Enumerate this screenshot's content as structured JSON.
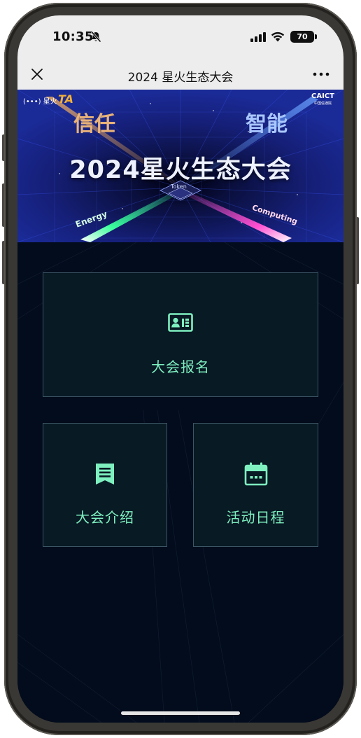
{
  "status_bar": {
    "time": "10:35",
    "battery_level": "70"
  },
  "nav": {
    "title": "2024 星火生态大会"
  },
  "banner": {
    "title": "2024星火生态大会",
    "word_left": "信任",
    "word_right": "智能",
    "label_center": "Token",
    "label_left": "Energy",
    "label_right": "Computing",
    "logo_left": "(•••) 星火",
    "logo_ta": "TA",
    "logo_right": "CAICT",
    "logo_right_sub": "中国信通院"
  },
  "menu": {
    "register_label": "大会报名",
    "intro_label": "大会介绍",
    "schedule_label": "活动日程"
  },
  "colors": {
    "accent": "#7ef0c0",
    "card_bg": "#081a24",
    "card_border": "#3b5565",
    "page_bg": "#030c1c"
  },
  "icons": {
    "register": "id-card-icon",
    "intro": "document-bookmark-icon",
    "schedule": "calendar-icon"
  }
}
